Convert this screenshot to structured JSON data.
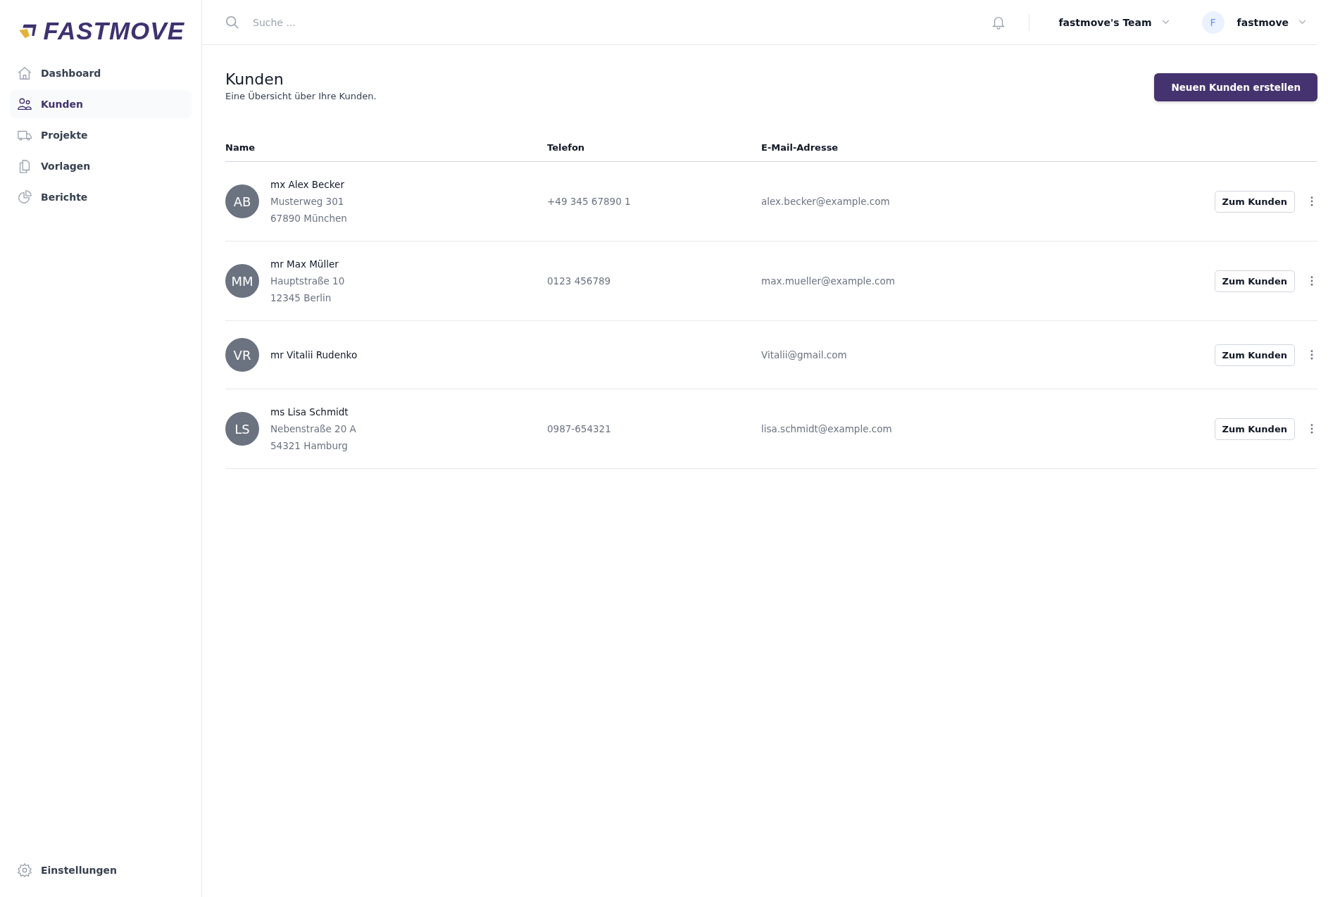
{
  "logo": {
    "text": "FASTMOVE"
  },
  "sidebar": {
    "items": [
      {
        "label": "Dashboard",
        "selected": false
      },
      {
        "label": "Kunden",
        "selected": true
      },
      {
        "label": "Projekte",
        "selected": false
      },
      {
        "label": "Vorlagen",
        "selected": false
      },
      {
        "label": "Berichte",
        "selected": false
      }
    ],
    "footer_item": {
      "label": "Einstellungen",
      "selected": false
    }
  },
  "topbar": {
    "search": {
      "placeholder": "Suche ..."
    },
    "team": "fastmove's Team",
    "user": {
      "initial": "F",
      "name": "fastmove"
    }
  },
  "page": {
    "title": "Kunden",
    "subtitle": "Eine Übersicht über Ihre Kunden.",
    "create_button": "Neuen Kunden erstellen"
  },
  "table": {
    "columns": [
      "Name",
      "Telefon",
      "E-Mail-Adresse"
    ],
    "rows": [
      {
        "initials": "AB",
        "name": "mx Alex Becker",
        "address": [
          "Musterweg 301",
          "67890 München"
        ],
        "phone": "+49 345 67890 1",
        "email": "alex.becker@example.com",
        "action": "Zum Kunden"
      },
      {
        "initials": "MM",
        "name": "mr Max Müller",
        "address": [
          "Hauptstraße 10",
          "12345 Berlin"
        ],
        "phone": "0123 456789",
        "email": "max.mueller@example.com",
        "action": "Zum Kunden"
      },
      {
        "initials": "VR",
        "name": "mr Vitalii Rudenko",
        "address": [],
        "email": "Vitalii@gmail.com",
        "action": "Zum Kunden"
      },
      {
        "initials": "LS",
        "name": "ms Lisa Schmidt",
        "address": [
          "Nebenstraße 20 A",
          "54321 Hamburg"
        ],
        "phone": "0987-654321",
        "email": "lisa.schmidt@example.com",
        "action": "Zum Kunden"
      }
    ]
  }
}
